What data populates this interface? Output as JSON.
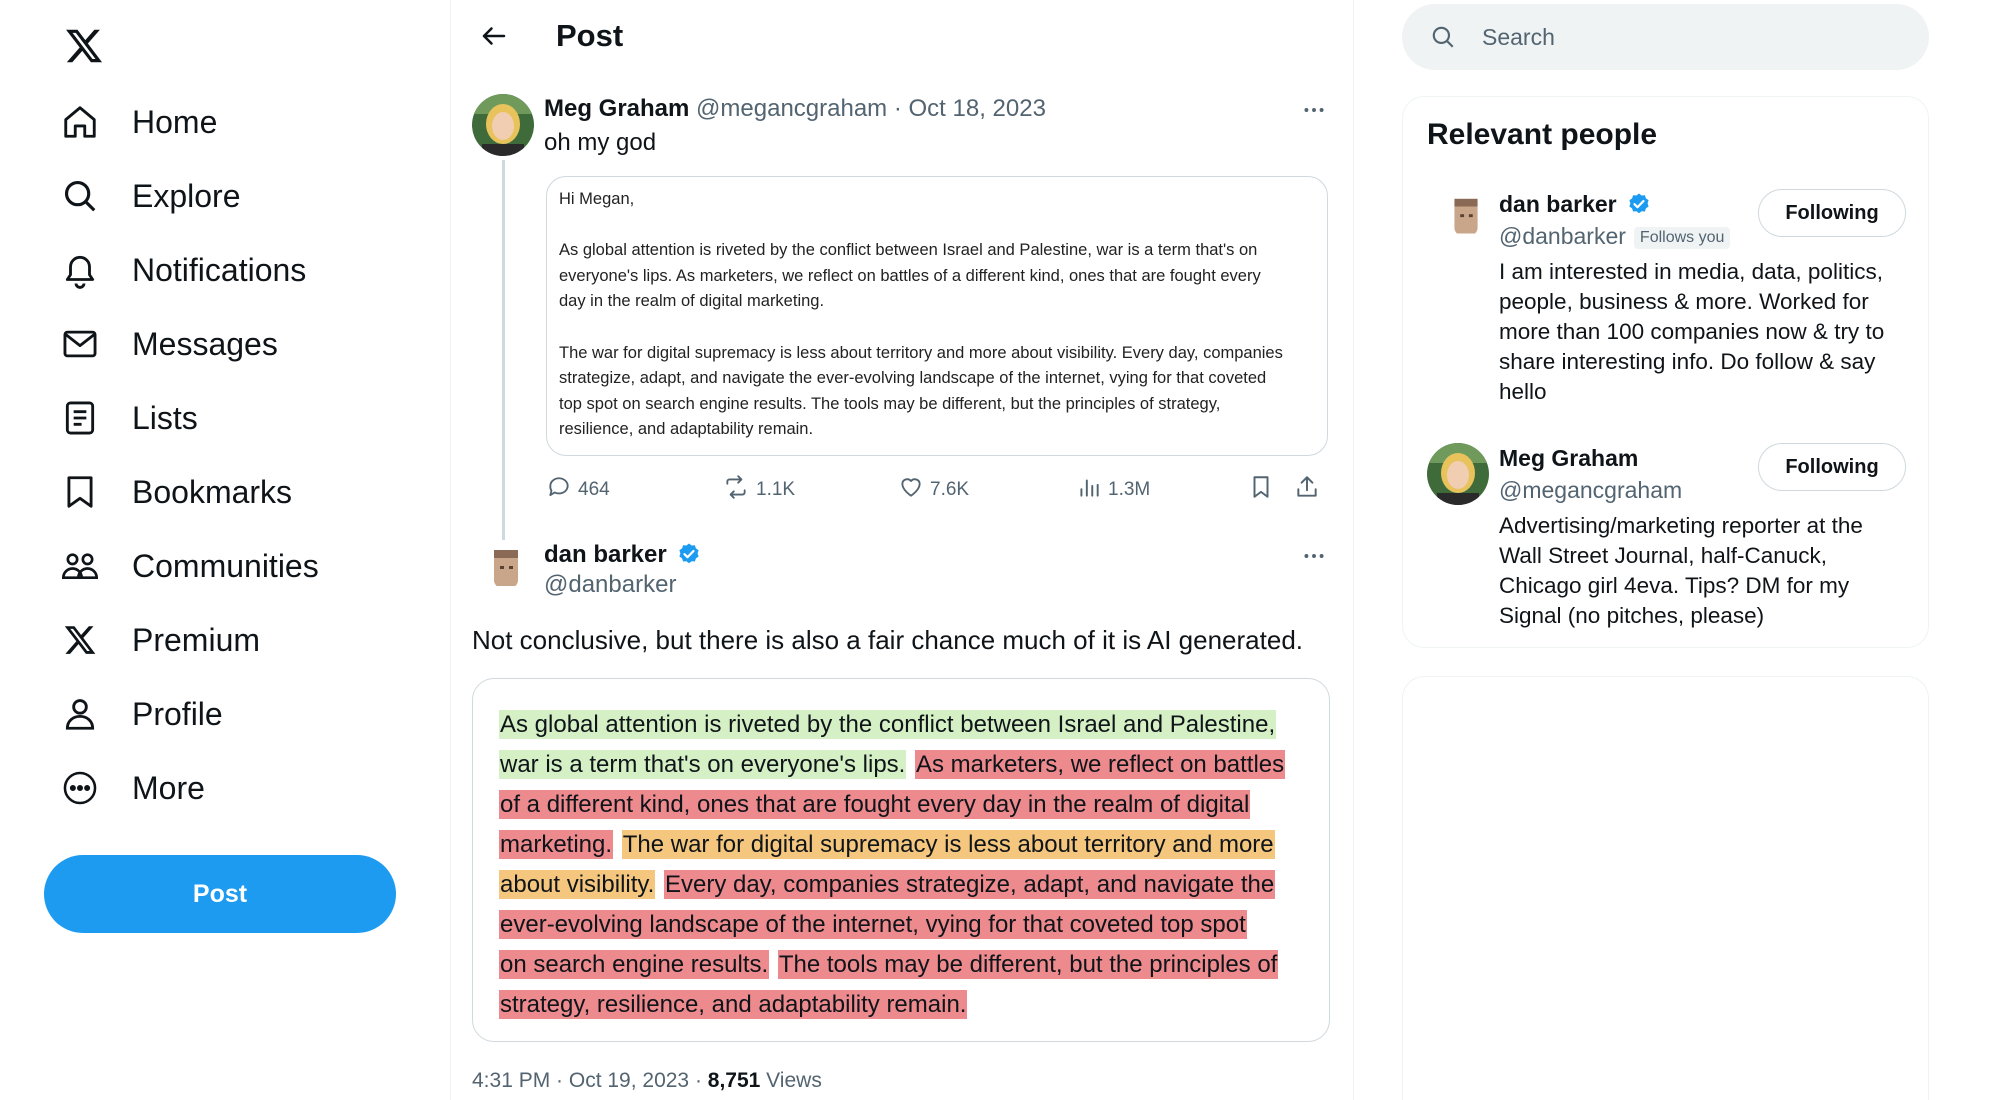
{
  "nav": {
    "logo": "x-logo-icon",
    "items": [
      {
        "label": "Home",
        "icon": "home-icon"
      },
      {
        "label": "Explore",
        "icon": "search-icon"
      },
      {
        "label": "Notifications",
        "icon": "bell-icon"
      },
      {
        "label": "Messages",
        "icon": "envelope-icon"
      },
      {
        "label": "Lists",
        "icon": "list-icon"
      },
      {
        "label": "Bookmarks",
        "icon": "bookmark-icon"
      },
      {
        "label": "Communities",
        "icon": "communities-icon"
      },
      {
        "label": "Premium",
        "icon": "x-logo-icon"
      },
      {
        "label": "Profile",
        "icon": "person-icon"
      },
      {
        "label": "More",
        "icon": "more-circle-icon"
      }
    ],
    "post_button": "Post"
  },
  "header": {
    "title": "Post"
  },
  "original_tweet": {
    "name": "Meg Graham",
    "handle": "@megancgraham",
    "date": "Oct 18, 2023",
    "text": "oh my god",
    "email": {
      "greeting": "Hi Megan,",
      "para1": [
        "As global attention is riveted by the conflict between Israel and Palestine, war is a term that's on",
        "everyone's lips. As marketers, we reflect on battles of a different kind, ones that are fought every",
        "day in the realm of digital marketing."
      ],
      "para2": [
        "The war for digital supremacy is less about territory and more about visibility. Every day, companies",
        "strategize, adapt, and navigate the ever-evolving landscape of the internet, vying for that coveted",
        "top spot on search engine results. The tools may be different, but the principles of strategy,",
        "resilience, and adaptability remain."
      ]
    },
    "stats": {
      "replies": "464",
      "reposts": "1.1K",
      "likes": "7.6K",
      "views": "1.3M"
    }
  },
  "reply_tweet": {
    "name": "dan barker",
    "handle": "@danbarker",
    "text": "Not conclusive, but there is also a fair chance much of it is AI generated.",
    "highlight_lines": [
      [
        {
          "text": "As global attention is riveted by the conflict between Israel and Palestine,",
          "color": "green"
        }
      ],
      [
        {
          "text": "war is a term that's on everyone's lips.",
          "color": "green"
        },
        {
          "text": " ",
          "color": "none"
        },
        {
          "text": "As marketers, we reflect on battles",
          "color": "red"
        }
      ],
      [
        {
          "text": "of a different kind, ones that are fought every day in the realm of digital",
          "color": "red"
        }
      ],
      [
        {
          "text": "marketing.",
          "color": "red"
        },
        {
          "text": " ",
          "color": "none"
        },
        {
          "text": "The war for digital supremacy is less about territory and more",
          "color": "orange"
        }
      ],
      [
        {
          "text": "about visibility.",
          "color": "orange"
        },
        {
          "text": " ",
          "color": "none"
        },
        {
          "text": "Every day, companies strategize, adapt, and navigate the",
          "color": "red"
        }
      ],
      [
        {
          "text": "ever-evolving landscape of the internet, vying for that coveted top spot",
          "color": "red"
        }
      ],
      [
        {
          "text": "on search engine results.",
          "color": "red"
        },
        {
          "text": " ",
          "color": "none"
        },
        {
          "text": "The tools may be different, but the principles of",
          "color": "red"
        }
      ],
      [
        {
          "text": "strategy, resilience, and adaptability remain.",
          "color": "red"
        }
      ]
    ],
    "time": "4:31 PM · Oct 19, 2023 · ",
    "view_count": "8,751",
    "views_label": " Views"
  },
  "search": {
    "placeholder": "Search"
  },
  "relevant_people": {
    "title": "Relevant people",
    "people": [
      {
        "name": "dan barker",
        "handle": "@danbarker",
        "follows_you": "Follows you",
        "button": "Following",
        "bio": "I am interested in media, data, politics, people, business & more. Worked for more than 100 companies now & try to share interesting info. Do follow & say hello"
      },
      {
        "name": "Meg Graham",
        "handle": "@megancgraham",
        "button": "Following",
        "bio": "Advertising/marketing reporter at the Wall Street Journal, half-Canuck, Chicago girl 4eva. Tips? DM for my Signal (no pitches, please)"
      }
    ]
  },
  "colors": {
    "accent": "#1d9bf0",
    "highlight_green": "#d5f0c4",
    "highlight_red": "#ec8a8e",
    "highlight_orange": "#f5c77e"
  }
}
